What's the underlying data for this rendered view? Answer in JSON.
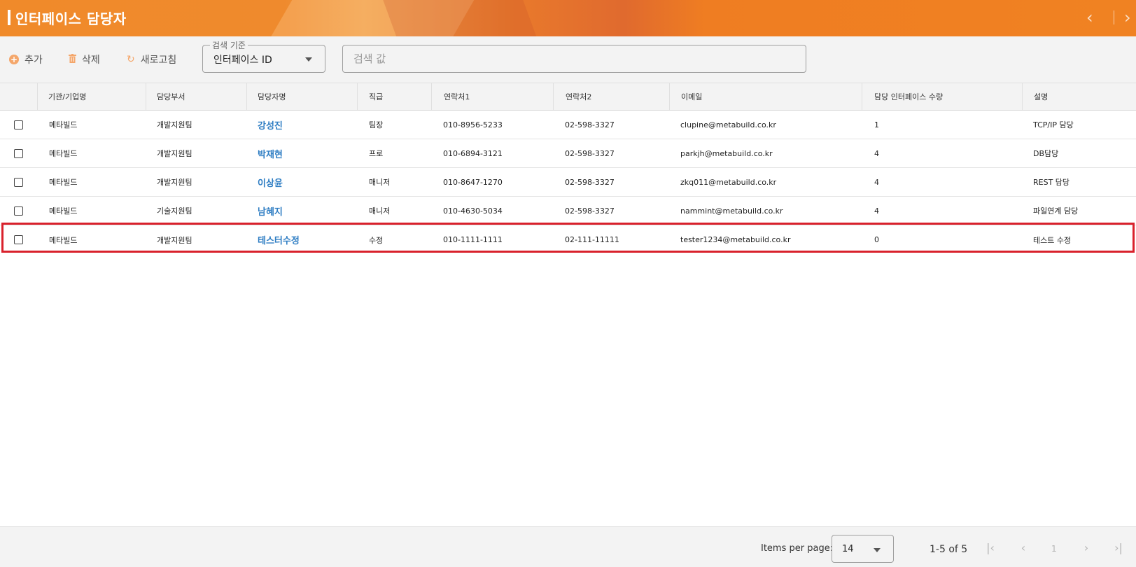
{
  "header": {
    "title": "인터페이스 담당자",
    "prev_icon": "‹",
    "next_icon": "›"
  },
  "toolbar": {
    "add_label": "추가",
    "delete_label": "삭제",
    "refresh_label": "새로고침",
    "search_criteria": {
      "legend": "검색 기준",
      "value": "인터페이스 ID"
    },
    "search_input": {
      "placeholder": "검색 값",
      "value": ""
    }
  },
  "table": {
    "columns": [
      "기관/기업명",
      "담당부서",
      "담당자명",
      "직급",
      "연락처1",
      "연락처2",
      "이메일",
      "담당 인터페이스 수량",
      "설명"
    ],
    "rows": [
      {
        "org": "메타빌드",
        "dept": "개발지원팀",
        "name": "강성진",
        "rank": "팀장",
        "phone1": "010-8956-5233",
        "phone2": "02-598-3327",
        "email": "clupine@metabuild.co.kr",
        "count": "1",
        "desc": "TCP/IP 담당"
      },
      {
        "org": "메타빌드",
        "dept": "개발지원팀",
        "name": "박재현",
        "rank": "프로",
        "phone1": "010-6894-3121",
        "phone2": "02-598-3327",
        "email": "parkjh@metabuild.co.kr",
        "count": "4",
        "desc": "DB담당"
      },
      {
        "org": "메타빌드",
        "dept": "개발지원팀",
        "name": "이상윤",
        "rank": "매니저",
        "phone1": "010-8647-1270",
        "phone2": "02-598-3327",
        "email": "zkq011@metabuild.co.kr",
        "count": "4",
        "desc": "REST 담당"
      },
      {
        "org": "메타빌드",
        "dept": "기술지원팀",
        "name": "남혜지",
        "rank": "매니저",
        "phone1": "010-4630-5034",
        "phone2": "02-598-3327",
        "email": "nammint@metabuild.co.kr",
        "count": "4",
        "desc": "파일연계 담당"
      },
      {
        "org": "메타빌드",
        "dept": "개발지원팀",
        "name": "테스터수정",
        "rank": "수정",
        "phone1": "010-1111-1111",
        "phone2": "02-111-11111",
        "email": "tester1234@metabuild.co.kr",
        "count": "0",
        "desc": "테스트 수정"
      }
    ],
    "highlight_color": "#d9212c",
    "link_color": "#2e7dc3"
  },
  "paginator": {
    "items_per_page_label": "Items per page:",
    "items_per_page": "14",
    "range_label": "1-5 of 5",
    "current_page": "1",
    "first_icon": "|‹",
    "prev_icon": "‹",
    "next_icon": "›",
    "last_icon": "›|"
  },
  "colors": {
    "header_orange": "#f08222",
    "accent": "#f4a66a"
  }
}
